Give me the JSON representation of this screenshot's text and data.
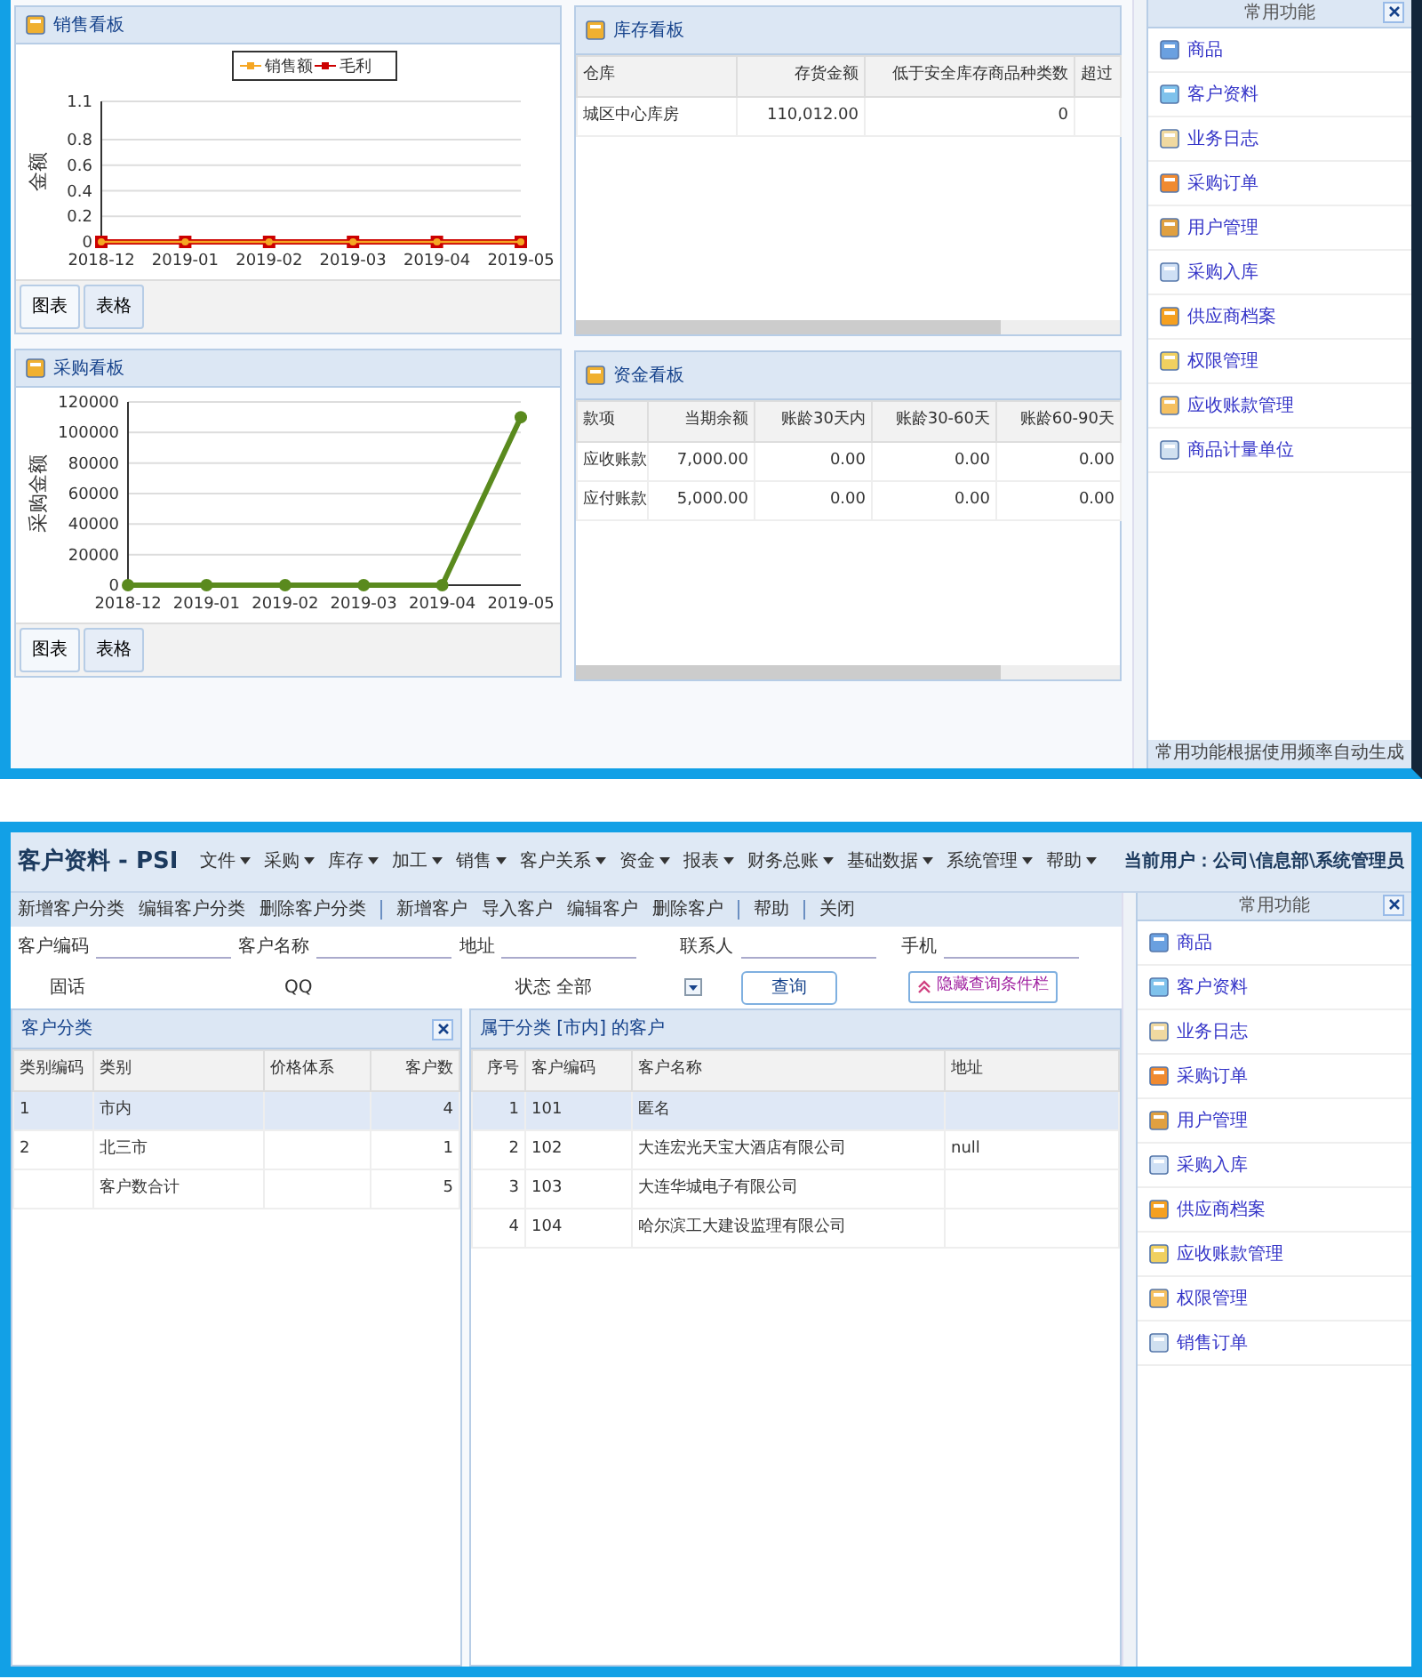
{
  "dashboard": {
    "sales_board": {
      "title": "销售看板",
      "chart_data": {
        "type": "line",
        "grid": true,
        "legend": true,
        "ylabel": "金额",
        "categories": [
          "2018-12",
          "2019-01",
          "2019-02",
          "2019-03",
          "2019-04",
          "2019-05"
        ],
        "ylim": [
          0,
          1.1
        ],
        "yticks": [
          0,
          0.2,
          0.4,
          0.6,
          0.8,
          1.1
        ],
        "series": [
          {
            "name": "销售额",
            "color": "#f5a623",
            "marker": "circle",
            "values": [
              0,
              0,
              0,
              0,
              0,
              0
            ]
          },
          {
            "name": "毛利",
            "color": "#cc0000",
            "marker": "square",
            "values": [
              0,
              0,
              0,
              0,
              0,
              0
            ]
          }
        ]
      },
      "tabs": [
        {
          "label": "图表",
          "selected": true
        },
        {
          "label": "表格",
          "selected": false
        }
      ]
    },
    "purchase_board": {
      "title": "采购看板",
      "chart_data": {
        "type": "line",
        "grid": true,
        "ylabel": "采购金额",
        "categories": [
          "2018-12",
          "2019-01",
          "2019-02",
          "2019-03",
          "2019-04",
          "2019-05"
        ],
        "ylim": [
          0,
          120000
        ],
        "yticks": [
          0,
          20000,
          40000,
          60000,
          80000,
          100000,
          120000
        ],
        "series": [
          {
            "color": "#5a8a1e",
            "marker": "circle",
            "values": [
              0,
              0,
              0,
              0,
              0,
              110000
            ]
          }
        ]
      },
      "tabs": [
        {
          "label": "图表",
          "selected": true
        },
        {
          "label": "表格",
          "selected": false
        }
      ]
    },
    "inventory_board": {
      "title": "库存看板",
      "columns": [
        "仓库",
        "存货金额",
        "低于安全库存商品种类数",
        "超过"
      ],
      "rows": [
        [
          "城区中心库房",
          "110,012.00",
          "0",
          null
        ]
      ]
    },
    "funds_board": {
      "title": "资金看板",
      "columns": [
        "款项",
        "当期余额",
        "账龄30天内",
        "账龄30-60天",
        "账龄60-90天"
      ],
      "rows": [
        [
          "应收账款",
          "7,000.00",
          "0.00",
          "0.00",
          "0.00"
        ],
        [
          "应付账款",
          "5,000.00",
          "0.00",
          "0.00",
          "0.00"
        ]
      ]
    },
    "sidebar": {
      "title": "常用功能",
      "items": [
        "商品",
        "客户资料",
        "业务日志",
        "采购订单",
        "用户管理",
        "采购入库",
        "供应商档案",
        "权限管理",
        "应收账款管理",
        "商品计量单位"
      ],
      "footer": "常用功能根据使用频率自动生成"
    }
  },
  "customer_window": {
    "title": "客户资料 - PSI",
    "menu": [
      "文件",
      "采购",
      "库存",
      "加工",
      "销售",
      "客户关系",
      "资金",
      "报表",
      "财务总账",
      "基础数据",
      "系统管理",
      "帮助"
    ],
    "current_user": "当前用户：公司\\信息部\\系统管理员",
    "toolbar": [
      [
        "新增客户分类",
        "编辑客户分类",
        "删除客户分类"
      ],
      [
        "新增客户",
        "导入客户",
        "编辑客户",
        "删除客户"
      ],
      [
        "帮助"
      ],
      [
        "关闭"
      ]
    ],
    "query_fields": [
      {
        "label": "客户编码"
      },
      {
        "label": "客户名称"
      },
      {
        "label": "地址"
      },
      {
        "label": "联系人"
      },
      {
        "label": "手机"
      }
    ],
    "query_fields_2": [
      {
        "label": "固话"
      },
      {
        "label": "QQ"
      }
    ],
    "status_select": {
      "label": "状态",
      "value": "全部"
    },
    "query_button": "查询",
    "hide_button": "隐藏查询条件栏",
    "category_panel": {
      "title": "客户分类",
      "columns": [
        "类别编码",
        "类别",
        "价格体系",
        "客户数"
      ],
      "rows": [
        {
          "cells": [
            "1",
            "市内",
            null,
            "4"
          ],
          "selected": true
        },
        {
          "cells": [
            "2",
            "北三市",
            null,
            "1"
          ],
          "selected": false
        },
        {
          "cells": [
            null,
            "客户数合计",
            null,
            "5"
          ],
          "selected": false
        }
      ]
    },
    "customer_panel": {
      "title": "属于分类 [市内] 的客户",
      "columns": [
        "序号",
        "客户编码",
        "客户名称",
        "地址"
      ],
      "rows": [
        {
          "cells": [
            "1",
            "101",
            "匿名",
            null
          ],
          "selected": true
        },
        {
          "cells": [
            "2",
            "102",
            "大连宏光天宝大酒店有限公司",
            "null"
          ],
          "selected": false
        },
        {
          "cells": [
            "3",
            "103",
            "大连华城电子有限公司",
            null
          ],
          "selected": false
        },
        {
          "cells": [
            "4",
            "104",
            "哈尔滨工大建设监理有限公司",
            null
          ],
          "selected": false
        }
      ]
    },
    "sidebar": {
      "title": "常用功能",
      "items": [
        "商品",
        "客户资料",
        "业务日志",
        "采购订单",
        "用户管理",
        "采购入库",
        "供应商档案",
        "应收账款管理",
        "权限管理",
        "销售订单"
      ]
    }
  }
}
